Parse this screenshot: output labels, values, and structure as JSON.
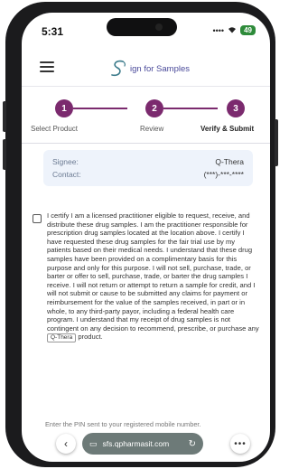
{
  "status_bar": {
    "time": "5:31",
    "battery": "49",
    "icons": [
      "wifi-icon",
      "battery-icon",
      "signal-icon"
    ]
  },
  "app": {
    "logo_text": "ign for Samples",
    "logo_letter": "S"
  },
  "stepper": {
    "steps": [
      {
        "number": "1",
        "label": "Select Product"
      },
      {
        "number": "2",
        "label": "Review"
      },
      {
        "number": "3",
        "label": "Verify & Submit"
      }
    ],
    "accent": "#7b2a6e"
  },
  "signee": {
    "signee_label": "Signee:",
    "signee_value": "Q-Thera",
    "contact_label": "Contact:",
    "contact_value": "(***)-***-****"
  },
  "consent": {
    "text": "I certify I am a licensed practitioner eligible to request, receive, and distribute these drug samples. I am the practitioner responsible for prescription drug samples located at the location above. I certify I have requested these drug samples for the fair trial use by my patients based on their medical needs. I understand that these drug samples have been provided on a complimentary basis for this purpose and only for this purpose. I will not sell, purchase, trade, or barter or offer to sell, purchase, trade, or barter the drug samples I receive. I will not return or attempt to return a sample for credit, and I will not submit or cause to be submitted any claims for payment or reimbursement for the value of the samples received, in part or in whole, to any third-party payor, including a federal health care program. I understand that my receipt of drug samples is not contingent on any decision to recommend, prescribe, or purchase any",
    "product_field": "Q-Thera",
    "suffix": "product."
  },
  "pin": {
    "instruction": "Enter the PIN sent to your registered mobile number."
  },
  "browser": {
    "url": "sfs.qpharmasit.com",
    "back": "‹",
    "more": "•••"
  }
}
